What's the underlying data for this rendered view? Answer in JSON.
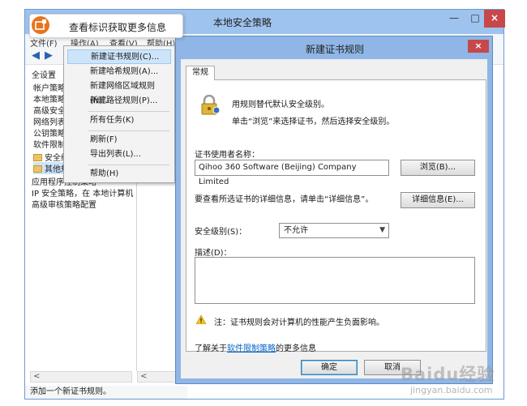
{
  "main_window": {
    "title": "本地安全策略",
    "controls": {
      "min": "—",
      "max": "□",
      "close": "×"
    },
    "menu": {
      "file": "文件(F)",
      "action": "操作(A)",
      "view": "查看(V)",
      "help": "帮助(H)"
    },
    "tree": [
      "全设置",
      "帐户策略",
      "本地策略",
      "高级安全",
      "网络列表",
      "公钥策略",
      "软件限制",
      "安全级",
      "其他规",
      "应用程序控制策略",
      "IP 安全策略，在 本地计算机",
      "高级审核策略配置"
    ],
    "status": "添加一个新证书规则。"
  },
  "context_menu": {
    "items": [
      "新建证书规则(C)...",
      "新建哈希规则(A)...",
      "新建网络区域规则(N)...",
      "新建路径规则(P)...",
      "所有任务(K)",
      "刷新(F)",
      "导出列表(L)...",
      "帮助(H)"
    ]
  },
  "dialog": {
    "title": "新建证书规则",
    "close": "×",
    "tab": "常规",
    "desc1": "用规则替代默认安全级别。",
    "desc2": "单击“浏览”来选择证书，然后选择安全级别。",
    "cert_label": "证书使用者名称：",
    "cert_value": "Qihoo 360 Software (Beijing) Company Limited",
    "browse": "浏览(B)...",
    "detail_hint": "要查看所选证书的详细信息，请单击“详细信息”。",
    "details": "详细信息(E)...",
    "level_label": "安全级别(S)：",
    "level_value": "不允许",
    "desc_label": "描述(D)：",
    "note": "注：证书规则会对计算机的性能产生负面影响。",
    "more_prefix": "了解关于",
    "more_link": "软件限制策略",
    "more_suffix": "的更多信息",
    "ok": "确定",
    "cancel": "取消"
  },
  "tooltip": {
    "text": "查看标识获取更多信息"
  },
  "watermark": {
    "text": "Baidu经验",
    "sub": "jingyan.baidu.com"
  }
}
